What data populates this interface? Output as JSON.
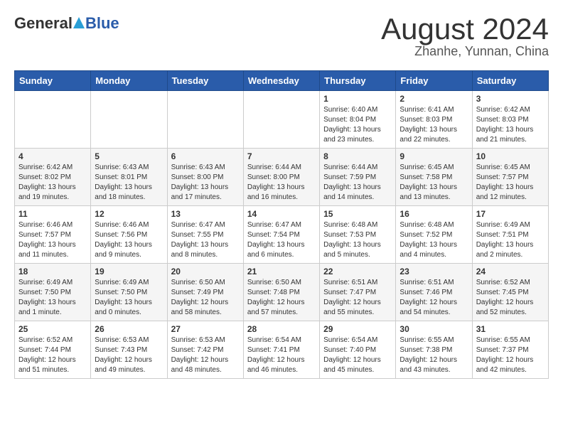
{
  "logo": {
    "general": "General",
    "blue": "Blue"
  },
  "title": "August 2024",
  "subtitle": "Zhanhe, Yunnan, China",
  "days_of_week": [
    "Sunday",
    "Monday",
    "Tuesday",
    "Wednesday",
    "Thursday",
    "Friday",
    "Saturday"
  ],
  "weeks": [
    [
      {
        "day": "",
        "info": ""
      },
      {
        "day": "",
        "info": ""
      },
      {
        "day": "",
        "info": ""
      },
      {
        "day": "",
        "info": ""
      },
      {
        "day": "1",
        "info": "Sunrise: 6:40 AM\nSunset: 8:04 PM\nDaylight: 13 hours and 23 minutes."
      },
      {
        "day": "2",
        "info": "Sunrise: 6:41 AM\nSunset: 8:03 PM\nDaylight: 13 hours and 22 minutes."
      },
      {
        "day": "3",
        "info": "Sunrise: 6:42 AM\nSunset: 8:03 PM\nDaylight: 13 hours and 21 minutes."
      }
    ],
    [
      {
        "day": "4",
        "info": "Sunrise: 6:42 AM\nSunset: 8:02 PM\nDaylight: 13 hours and 19 minutes."
      },
      {
        "day": "5",
        "info": "Sunrise: 6:43 AM\nSunset: 8:01 PM\nDaylight: 13 hours and 18 minutes."
      },
      {
        "day": "6",
        "info": "Sunrise: 6:43 AM\nSunset: 8:00 PM\nDaylight: 13 hours and 17 minutes."
      },
      {
        "day": "7",
        "info": "Sunrise: 6:44 AM\nSunset: 8:00 PM\nDaylight: 13 hours and 16 minutes."
      },
      {
        "day": "8",
        "info": "Sunrise: 6:44 AM\nSunset: 7:59 PM\nDaylight: 13 hours and 14 minutes."
      },
      {
        "day": "9",
        "info": "Sunrise: 6:45 AM\nSunset: 7:58 PM\nDaylight: 13 hours and 13 minutes."
      },
      {
        "day": "10",
        "info": "Sunrise: 6:45 AM\nSunset: 7:57 PM\nDaylight: 13 hours and 12 minutes."
      }
    ],
    [
      {
        "day": "11",
        "info": "Sunrise: 6:46 AM\nSunset: 7:57 PM\nDaylight: 13 hours and 11 minutes."
      },
      {
        "day": "12",
        "info": "Sunrise: 6:46 AM\nSunset: 7:56 PM\nDaylight: 13 hours and 9 minutes."
      },
      {
        "day": "13",
        "info": "Sunrise: 6:47 AM\nSunset: 7:55 PM\nDaylight: 13 hours and 8 minutes."
      },
      {
        "day": "14",
        "info": "Sunrise: 6:47 AM\nSunset: 7:54 PM\nDaylight: 13 hours and 6 minutes."
      },
      {
        "day": "15",
        "info": "Sunrise: 6:48 AM\nSunset: 7:53 PM\nDaylight: 13 hours and 5 minutes."
      },
      {
        "day": "16",
        "info": "Sunrise: 6:48 AM\nSunset: 7:52 PM\nDaylight: 13 hours and 4 minutes."
      },
      {
        "day": "17",
        "info": "Sunrise: 6:49 AM\nSunset: 7:51 PM\nDaylight: 13 hours and 2 minutes."
      }
    ],
    [
      {
        "day": "18",
        "info": "Sunrise: 6:49 AM\nSunset: 7:50 PM\nDaylight: 13 hours and 1 minute."
      },
      {
        "day": "19",
        "info": "Sunrise: 6:49 AM\nSunset: 7:50 PM\nDaylight: 13 hours and 0 minutes."
      },
      {
        "day": "20",
        "info": "Sunrise: 6:50 AM\nSunset: 7:49 PM\nDaylight: 12 hours and 58 minutes."
      },
      {
        "day": "21",
        "info": "Sunrise: 6:50 AM\nSunset: 7:48 PM\nDaylight: 12 hours and 57 minutes."
      },
      {
        "day": "22",
        "info": "Sunrise: 6:51 AM\nSunset: 7:47 PM\nDaylight: 12 hours and 55 minutes."
      },
      {
        "day": "23",
        "info": "Sunrise: 6:51 AM\nSunset: 7:46 PM\nDaylight: 12 hours and 54 minutes."
      },
      {
        "day": "24",
        "info": "Sunrise: 6:52 AM\nSunset: 7:45 PM\nDaylight: 12 hours and 52 minutes."
      }
    ],
    [
      {
        "day": "25",
        "info": "Sunrise: 6:52 AM\nSunset: 7:44 PM\nDaylight: 12 hours and 51 minutes."
      },
      {
        "day": "26",
        "info": "Sunrise: 6:53 AM\nSunset: 7:43 PM\nDaylight: 12 hours and 49 minutes."
      },
      {
        "day": "27",
        "info": "Sunrise: 6:53 AM\nSunset: 7:42 PM\nDaylight: 12 hours and 48 minutes."
      },
      {
        "day": "28",
        "info": "Sunrise: 6:54 AM\nSunset: 7:41 PM\nDaylight: 12 hours and 46 minutes."
      },
      {
        "day": "29",
        "info": "Sunrise: 6:54 AM\nSunset: 7:40 PM\nDaylight: 12 hours and 45 minutes."
      },
      {
        "day": "30",
        "info": "Sunrise: 6:55 AM\nSunset: 7:38 PM\nDaylight: 12 hours and 43 minutes."
      },
      {
        "day": "31",
        "info": "Sunrise: 6:55 AM\nSunset: 7:37 PM\nDaylight: 12 hours and 42 minutes."
      }
    ]
  ]
}
